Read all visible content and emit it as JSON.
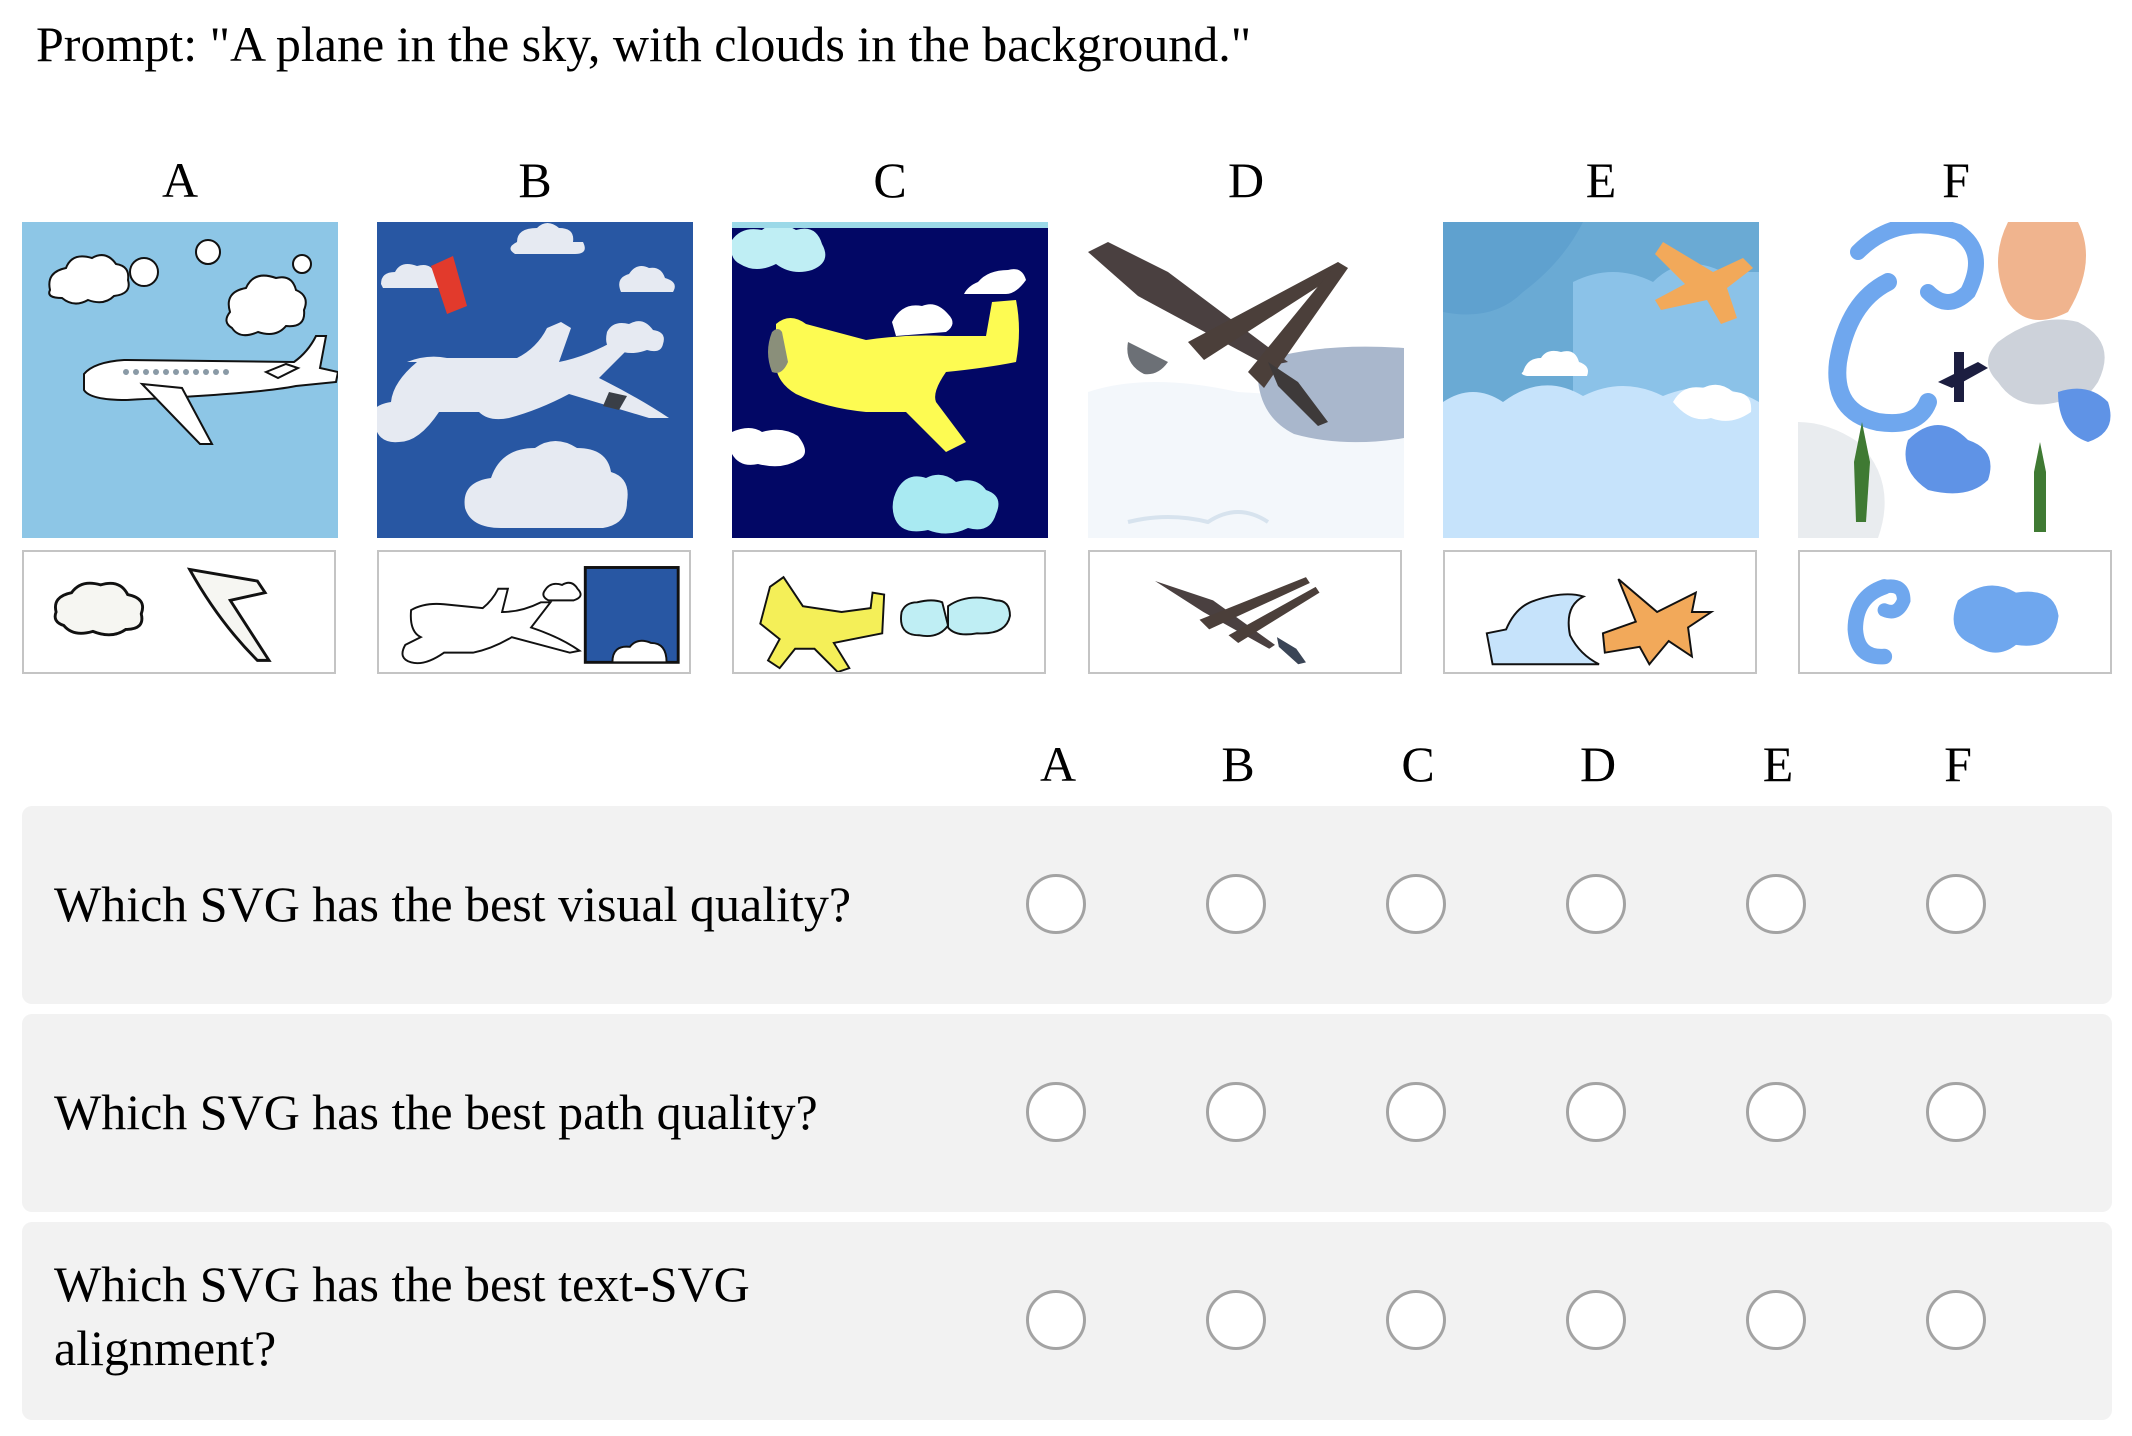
{
  "prompt_text": "Prompt: \"A plane in the sky, with clouds in the background.\"",
  "columns": [
    {
      "letter": "A"
    },
    {
      "letter": "B"
    },
    {
      "letter": "C"
    },
    {
      "letter": "D"
    },
    {
      "letter": "E"
    },
    {
      "letter": "F"
    }
  ],
  "options": [
    "A",
    "B",
    "C",
    "D",
    "E",
    "F"
  ],
  "questions": [
    {
      "text": "Which SVG has the best visual quality?"
    },
    {
      "text": "Which SVG has the best path quality?"
    },
    {
      "text": "Which SVG has the best text-SVG alignment?"
    }
  ],
  "colors": {
    "row_background": "#f2f2f2",
    "radio_border": "#a3a3a3",
    "part_border": "#c4c4c4"
  }
}
